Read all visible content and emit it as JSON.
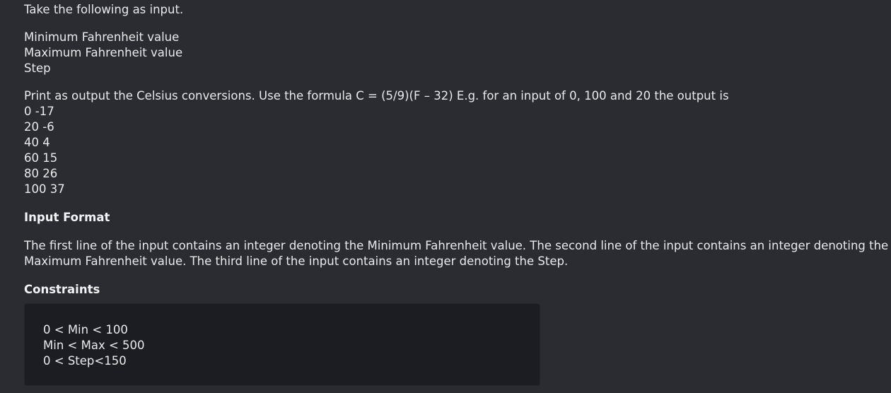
{
  "problem": {
    "intro": "Take the following as input.",
    "inputs": [
      "Minimum Fahrenheit value",
      "Maximum Fahrenheit value",
      "Step"
    ],
    "output_description": "Print as output the Celsius conversions. Use the formula C = (5/9)(F – 32) E.g. for an input of 0, 100 and 20 the output is",
    "sample_output": [
      "0 -17",
      "20 -6",
      "40 4",
      "60 15",
      "80 26",
      "100 37"
    ],
    "input_format_heading": "Input Format",
    "input_format_line1": "The first line of the input contains an integer denoting the Minimum Fahrenheit value. The second line of the input contains an integer denoting the",
    "input_format_line2": "Maximum Fahrenheit value. The third line of the input contains an integer denoting the Step.",
    "constraints_heading": "Constraints",
    "constraints": [
      "0 < Min < 100",
      "Min < Max < 500",
      "0 < Step<150"
    ]
  }
}
